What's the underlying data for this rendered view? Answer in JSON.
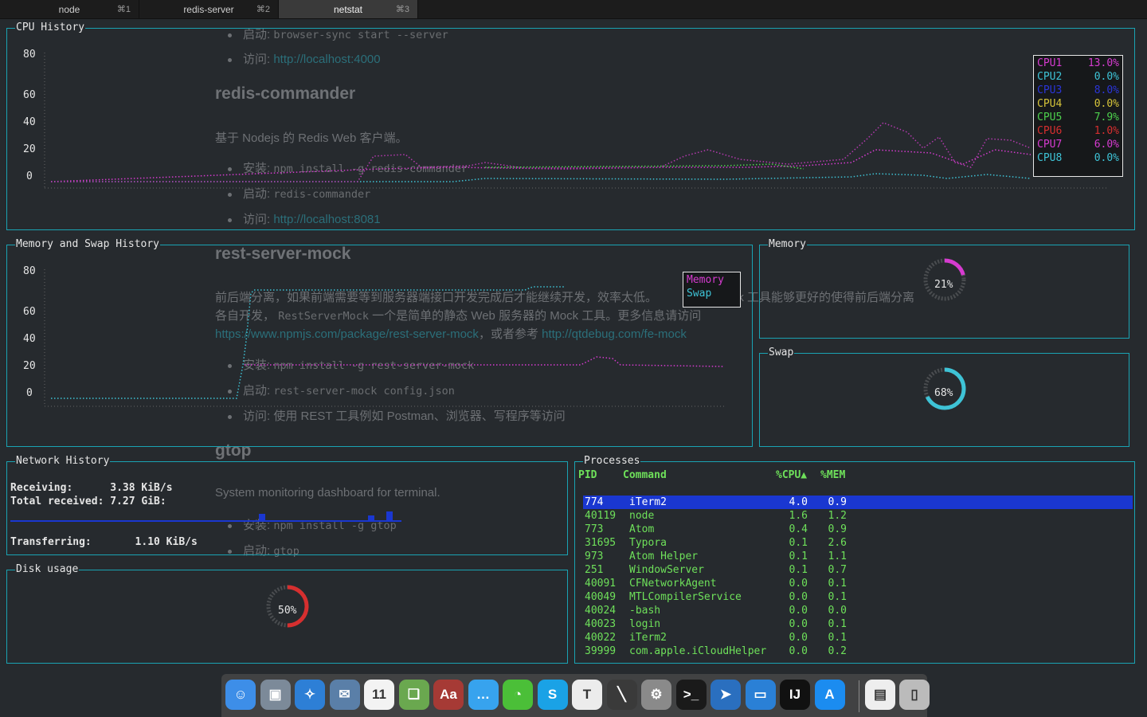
{
  "tabs": [
    {
      "label": "node",
      "shortcut": "⌘1",
      "active": false
    },
    {
      "label": "redis-server",
      "shortcut": "⌘2",
      "active": false
    },
    {
      "label": "netstat",
      "shortcut": "⌘3",
      "active": true
    }
  ],
  "background_doc": {
    "line1_label": "启动:",
    "line1_code": "browser-sync start --server",
    "line2_label": "访问:",
    "line2_link": "http://localhost:4000",
    "heading1": "redis-commander",
    "para1": "基于 Nodejs 的 Redis Web 客户端。",
    "line3_label": "安装:",
    "line3_code": "npm install -g redis-commander",
    "line4_label": "启动:",
    "line4_code": "redis-commander",
    "line5_label": "访问:",
    "line5_link": "http://localhost:8081",
    "heading2": "rest-server-mock",
    "para2a": "前后端分离，如果前端需要等到服务器端接口开发完成后才能继续开发，效率太低。",
    "para2a_tail": "Mock 工具能够更好的使得前后端分离",
    "para2b_pre": "各自开发，",
    "para2b_code": "RestServerMock",
    "para2b_post": "一个是简单的静态 Web 服务器的 Mock 工具。更多信息请访问",
    "para2c_link1": "https://www.npmjs.com/package/rest-server-mock",
    "para2c_mid": "，或者参考",
    "para2c_link2": "http://qtdebug.com/fe-mock",
    "line6_label": "安装:",
    "line6_code": "npm install -g rest-server-mock",
    "line7_label": "启动:",
    "line7_code": "rest-server-mock config.json",
    "line8_text": "访问: 使用 REST 工具例如 Postman、浏览器、写程序等访问",
    "heading3": "gtop",
    "para3": "System monitoring dashboard for terminal.",
    "line9_label": "安装:",
    "line9_code": "npm install -g gtop",
    "line10_label": "启动:",
    "line10_code": "gtop"
  },
  "cpu_history": {
    "title": "CPU History",
    "y_ticks": [
      "80",
      "60",
      "40",
      "20",
      "0"
    ],
    "legend": [
      {
        "name": "CPU1",
        "value": "13.0%",
        "color": "#d63bd0"
      },
      {
        "name": "CPU2",
        "value": "0.0%",
        "color": "#3ec3d6"
      },
      {
        "name": "CPU3",
        "value": "8.0%",
        "color": "#2b35d8"
      },
      {
        "name": "CPU4",
        "value": "0.0%",
        "color": "#d6c43a"
      },
      {
        "name": "CPU5",
        "value": "7.9%",
        "color": "#4dd14d"
      },
      {
        "name": "CPU6",
        "value": "1.0%",
        "color": "#d62f2f"
      },
      {
        "name": "CPU7",
        "value": "6.0%",
        "color": "#d63bd0"
      },
      {
        "name": "CPU8",
        "value": "0.0%",
        "color": "#3ec3d6"
      }
    ]
  },
  "mem_history": {
    "title": "Memory and Swap History",
    "y_ticks": [
      "80",
      "60",
      "40",
      "20",
      "0"
    ],
    "legend": [
      {
        "name": "Memory",
        "color": "#d63bd0"
      },
      {
        "name": "Swap",
        "color": "#3ec3d6"
      }
    ]
  },
  "memory": {
    "title": "Memory",
    "percent_label": "21%",
    "percent": 21,
    "color": "#d63bd0"
  },
  "swap": {
    "title": "Swap",
    "percent_label": "68%",
    "percent": 68,
    "color": "#3ec3d6"
  },
  "network": {
    "title": "Network History",
    "receiving_label": "Receiving:",
    "receiving_value": "3.38 KiB/s",
    "total_label": "Total received:",
    "total_value": "7.27 GiB:",
    "transferring_label": "Transferring:",
    "transferring_value": "1.10 KiB/s"
  },
  "disk": {
    "title": "Disk usage",
    "percent_label": "50%",
    "percent": 50,
    "color": "#d62f2f"
  },
  "processes": {
    "title": "Processes",
    "headers": {
      "pid": "PID",
      "command": "Command",
      "cpu": "%CPU▲",
      "mem": "%MEM"
    },
    "rows": [
      {
        "pid": "774",
        "command": "iTerm2",
        "cpu": "4.0",
        "mem": "0.9",
        "selected": true
      },
      {
        "pid": "40119",
        "command": "node",
        "cpu": "1.6",
        "mem": "1.2"
      },
      {
        "pid": "773",
        "command": "Atom",
        "cpu": "0.4",
        "mem": "0.9"
      },
      {
        "pid": "31695",
        "command": "Typora",
        "cpu": "0.1",
        "mem": "2.6"
      },
      {
        "pid": "973",
        "command": "Atom Helper",
        "cpu": "0.1",
        "mem": "1.1"
      },
      {
        "pid": "251",
        "command": "WindowServer",
        "cpu": "0.1",
        "mem": "0.7"
      },
      {
        "pid": "40091",
        "command": "CFNetworkAgent",
        "cpu": "0.0",
        "mem": "0.1"
      },
      {
        "pid": "40049",
        "command": "MTLCompilerService",
        "cpu": "0.0",
        "mem": "0.1"
      },
      {
        "pid": "40024",
        "command": "-bash",
        "cpu": "0.0",
        "mem": "0.0"
      },
      {
        "pid": "40023",
        "command": "login",
        "cpu": "0.0",
        "mem": "0.1"
      },
      {
        "pid": "40022",
        "command": "iTerm2",
        "cpu": "0.0",
        "mem": "0.1"
      },
      {
        "pid": "39999",
        "command": "com.apple.iCloudHelper",
        "cpu": "0.0",
        "mem": "0.2"
      }
    ]
  },
  "dock": {
    "items": [
      {
        "name": "finder-icon",
        "glyph": "☺",
        "bg": "#3d8ee8"
      },
      {
        "name": "preview-icon",
        "glyph": "▣",
        "bg": "#7c8a99"
      },
      {
        "name": "safari-icon",
        "glyph": "✧",
        "bg": "#2d7fd6"
      },
      {
        "name": "mail-icon",
        "glyph": "✉",
        "bg": "#5a7fa8"
      },
      {
        "name": "calendar-icon",
        "glyph": "11",
        "bg": "#f3f3f3"
      },
      {
        "name": "books-icon",
        "glyph": "❏",
        "bg": "#6aa84f"
      },
      {
        "name": "dictionary-icon",
        "glyph": "Aa",
        "bg": "#a63a35"
      },
      {
        "name": "messages-icon",
        "glyph": "…",
        "bg": "#37a3ee"
      },
      {
        "name": "wechat-icon",
        "glyph": "◔",
        "bg": "#4bbf38"
      },
      {
        "name": "skype-icon",
        "glyph": "S",
        "bg": "#1aa2e6"
      },
      {
        "name": "typora-icon",
        "glyph": "T",
        "bg": "#ececec"
      },
      {
        "name": "pen-icon",
        "glyph": "╲",
        "bg": "#3a3a3a"
      },
      {
        "name": "forklift-icon",
        "glyph": "⚙",
        "bg": "#8a8a8a"
      },
      {
        "name": "terminal-icon",
        "glyph": ">_",
        "bg": "#1a1a1a"
      },
      {
        "name": "arrow-app-icon",
        "glyph": "➤",
        "bg": "#2a6fbf"
      },
      {
        "name": "keynote-icon",
        "glyph": "▭",
        "bg": "#2a80d6"
      },
      {
        "name": "intellij-icon",
        "glyph": "IJ",
        "bg": "#111111"
      },
      {
        "name": "app-store-icon",
        "glyph": "A",
        "bg": "#1b8cf0"
      },
      {
        "name": "document-icon",
        "glyph": "▤",
        "bg": "#eeeeee"
      },
      {
        "name": "trash-icon",
        "glyph": "▯",
        "bg": "#bbbbbb"
      }
    ]
  }
}
